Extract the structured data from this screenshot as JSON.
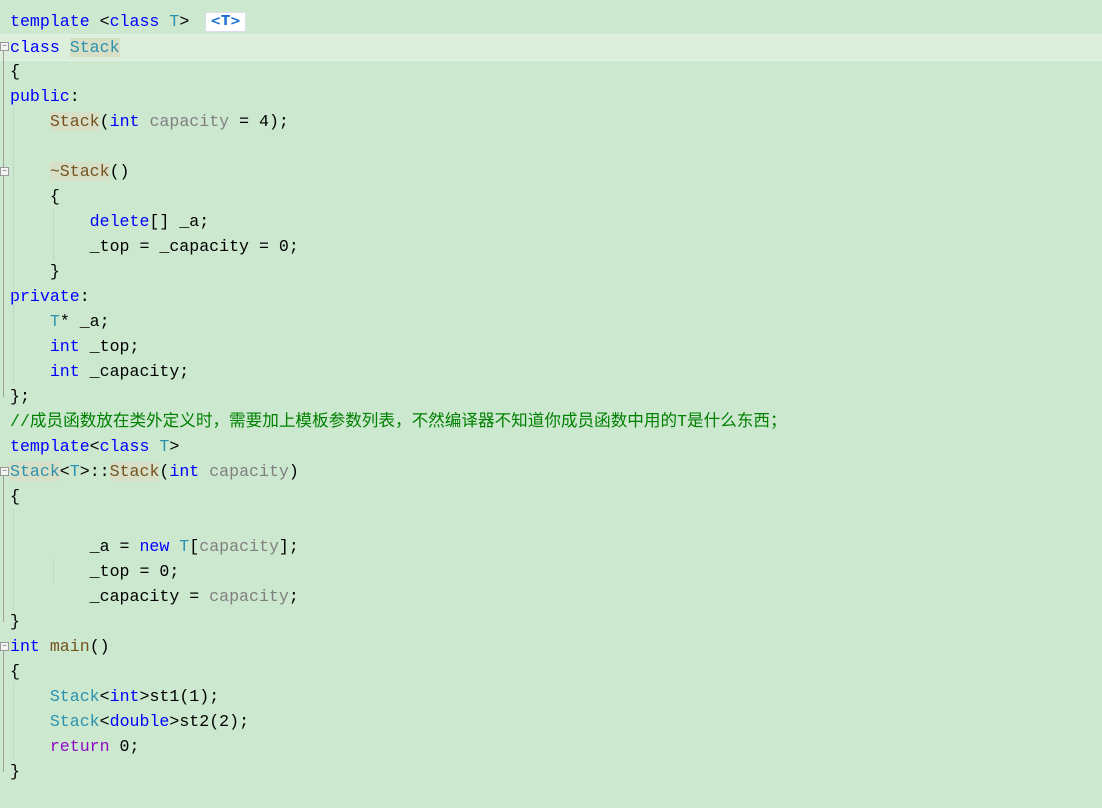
{
  "editor": {
    "background": "#cce8cf",
    "template_badge": "<T>",
    "highlighted_line": 1,
    "lines": [
      [
        [
          "kw",
          "template "
        ],
        [
          "pl",
          "<"
        ],
        [
          "kw",
          "class "
        ],
        [
          "ty",
          "T"
        ],
        [
          "pl",
          ">"
        ]
      ],
      [
        [
          "kw",
          "class "
        ],
        [
          "ty ref",
          "Stack"
        ]
      ],
      [
        [
          "pl",
          "{"
        ]
      ],
      [
        [
          "kw",
          "public"
        ],
        [
          "pl",
          ":"
        ]
      ],
      [
        [
          "pl",
          "    "
        ],
        [
          "fn ref",
          "Stack"
        ],
        [
          "pl",
          "("
        ],
        [
          "kw",
          "int "
        ],
        [
          "pa",
          "capacity"
        ],
        [
          "pl",
          " = 4);"
        ]
      ],
      [],
      [
        [
          "pl",
          "    "
        ],
        [
          "fn ref",
          "~Stack"
        ],
        [
          "pl",
          "()"
        ]
      ],
      [
        [
          "pl",
          "    {"
        ]
      ],
      [
        [
          "pl",
          "        "
        ],
        [
          "kw",
          "delete"
        ],
        [
          "pl",
          "[] _a;"
        ]
      ],
      [
        [
          "pl",
          "        _top = _capacity = 0;"
        ]
      ],
      [
        [
          "pl",
          "    }"
        ]
      ],
      [
        [
          "kw",
          "private"
        ],
        [
          "pl",
          ":"
        ]
      ],
      [
        [
          "pl",
          "    "
        ],
        [
          "ty",
          "T"
        ],
        [
          "pl",
          "* _a;"
        ]
      ],
      [
        [
          "pl",
          "    "
        ],
        [
          "kw",
          "int"
        ],
        [
          "pl",
          " _top;"
        ]
      ],
      [
        [
          "pl",
          "    "
        ],
        [
          "kw",
          "int"
        ],
        [
          "pl",
          " _capacity;"
        ]
      ],
      [
        [
          "pl",
          "};"
        ]
      ],
      [
        [
          "cm",
          "//成员函数放在类外定义时，需要加上模板参数列表，不然编译器不知道你成员函数中用的T是什么东西；"
        ]
      ],
      [
        [
          "kw",
          "template"
        ],
        [
          "pl",
          "<"
        ],
        [
          "kw",
          "class "
        ],
        [
          "ty",
          "T"
        ],
        [
          "pl",
          ">"
        ]
      ],
      [
        [
          "ty ref",
          "Stack"
        ],
        [
          "pl",
          "<"
        ],
        [
          "ty",
          "T"
        ],
        [
          "pl",
          ">::"
        ],
        [
          "fn ref",
          "Stack"
        ],
        [
          "pl",
          "("
        ],
        [
          "kw",
          "int "
        ],
        [
          "pa",
          "capacity"
        ],
        [
          "pl",
          ")"
        ]
      ],
      [
        [
          "pl",
          "{"
        ]
      ],
      [],
      [
        [
          "pl",
          "        _a = "
        ],
        [
          "kw",
          "new "
        ],
        [
          "ty",
          "T"
        ],
        [
          "pl",
          "["
        ],
        [
          "pa",
          "capacity"
        ],
        [
          "pl",
          "];"
        ]
      ],
      [
        [
          "pl",
          "        _top = 0;"
        ]
      ],
      [
        [
          "pl",
          "        _capacity = "
        ],
        [
          "pa",
          "capacity"
        ],
        [
          "pl",
          ";"
        ]
      ],
      [
        [
          "pl",
          "}"
        ]
      ],
      [
        [
          "kw",
          "int "
        ],
        [
          "fn",
          "main"
        ],
        [
          "pl",
          "()"
        ]
      ],
      [
        [
          "pl",
          "{"
        ]
      ],
      [
        [
          "pl",
          "    "
        ],
        [
          "ty",
          "Stack"
        ],
        [
          "pl",
          "<"
        ],
        [
          "kw",
          "int"
        ],
        [
          "pl",
          ">st1(1);"
        ]
      ],
      [
        [
          "pl",
          "    "
        ],
        [
          "ty",
          "Stack"
        ],
        [
          "pl",
          "<"
        ],
        [
          "kw",
          "double"
        ],
        [
          "pl",
          ">st2(2);"
        ]
      ],
      [
        [
          "pl",
          "    "
        ],
        [
          "rt",
          "return"
        ],
        [
          "pl",
          " 0;"
        ]
      ],
      [
        [
          "pl",
          "}"
        ]
      ]
    ]
  }
}
